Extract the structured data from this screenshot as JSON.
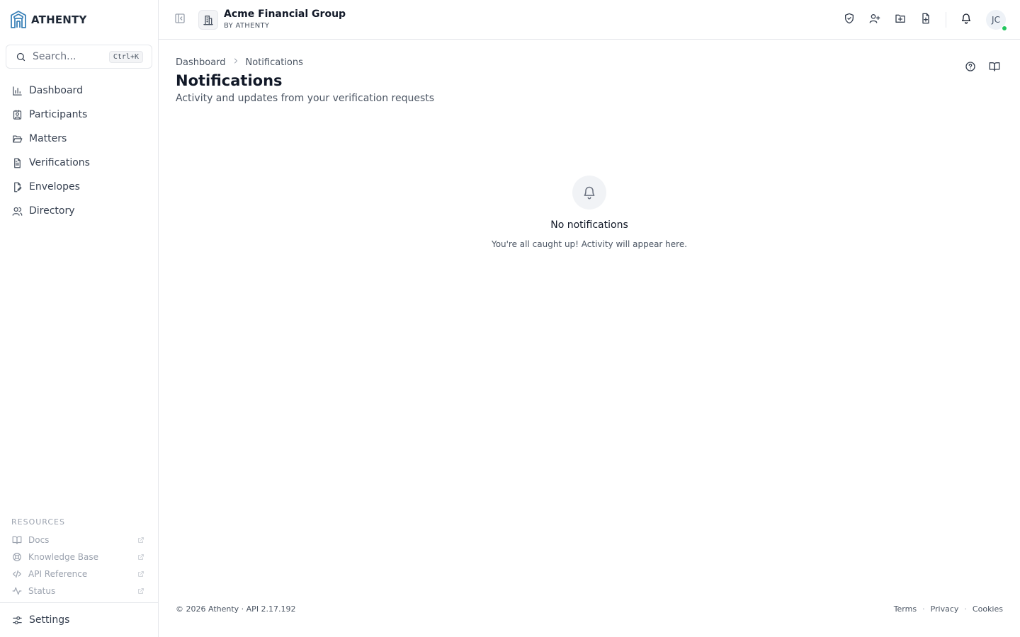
{
  "brand": {
    "name": "ATHENTY",
    "accent": "#3b82b8"
  },
  "search": {
    "placeholder": "Search...",
    "shortcut": "Ctrl+K"
  },
  "sidebar": {
    "items": [
      {
        "label": "Dashboard",
        "icon": "bar-chart-icon"
      },
      {
        "label": "Participants",
        "icon": "contact-icon"
      },
      {
        "label": "Matters",
        "icon": "folder-open-icon"
      },
      {
        "label": "Verifications",
        "icon": "file-text-icon"
      },
      {
        "label": "Envelopes",
        "icon": "file-signature-icon"
      },
      {
        "label": "Directory",
        "icon": "users-icon"
      }
    ],
    "resources_title": "RESOURCES",
    "resources": [
      {
        "label": "Docs",
        "icon": "book-icon"
      },
      {
        "label": "Knowledge Base",
        "icon": "life-buoy-icon"
      },
      {
        "label": "API Reference",
        "icon": "code-icon"
      },
      {
        "label": "Status",
        "icon": "activity-icon"
      }
    ],
    "settings_label": "Settings"
  },
  "header": {
    "org_name": "Acme Financial Group",
    "org_sub": "BY ATHENTY",
    "avatar_initials": "JC",
    "presence_color": "#22c55e"
  },
  "main": {
    "breadcrumb": [
      "Dashboard",
      "Notifications"
    ],
    "title": "Notifications",
    "subtitle": "Activity and updates from your verification requests",
    "empty_title": "No notifications",
    "empty_text": "You're all caught up! Activity will appear here."
  },
  "footer": {
    "copyright": "© 2026 Athenty · API 2.17.192",
    "links": [
      "Terms",
      "Privacy",
      "Cookies"
    ],
    "separator": "·"
  }
}
